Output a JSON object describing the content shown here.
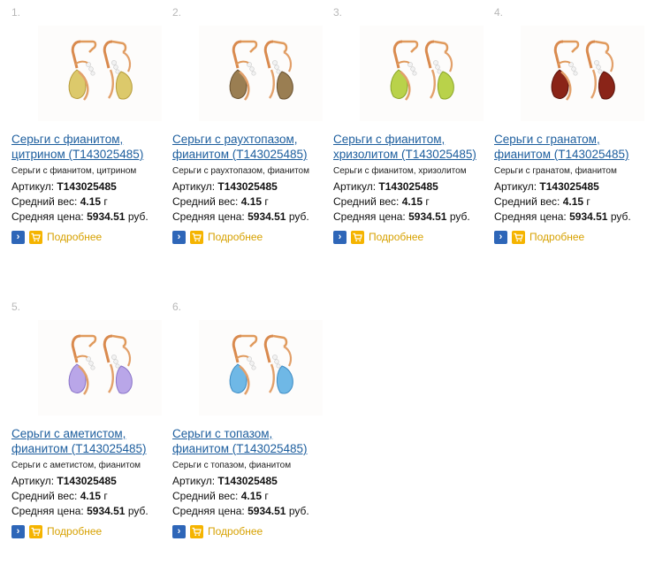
{
  "labels": {
    "article_label": "Артикул:",
    "weight_label": "Средний вес:",
    "price_label": "Средняя цена:",
    "more_label": "Подробнее",
    "go_icon": "›"
  },
  "products": [
    {
      "number": "1.",
      "title_line1": "Серьги с фианитом,",
      "title_line2": "цитрином (T143025485)",
      "desc": "Серьги с фианитом, цитрином",
      "article": "T143025485",
      "weight": "4.15",
      "weight_unit": "г",
      "price": "5934.51",
      "currency": "руб.",
      "stone_color": "#dcc96b",
      "stone_color_dark": "#b79c3c"
    },
    {
      "number": "2.",
      "title_line1": "Серьги с раухтопазом,",
      "title_line2": "фианитом (T143025485)",
      "desc": "Серьги с раухтопазом, фианитом",
      "article": "T143025485",
      "weight": "4.15",
      "weight_unit": "г",
      "price": "5934.51",
      "currency": "руб.",
      "stone_color": "#9a7e52",
      "stone_color_dark": "#6a5230"
    },
    {
      "number": "3.",
      "title_line1": "Серьги с фианитом,",
      "title_line2": "хризолитом (T143025485)",
      "desc": "Серьги с фианитом, хризолитом",
      "article": "T143025485",
      "weight": "4.15",
      "weight_unit": "г",
      "price": "5934.51",
      "currency": "руб.",
      "stone_color": "#b9d24a",
      "stone_color_dark": "#8aa528"
    },
    {
      "number": "4.",
      "title_line1": "Серьги с гранатом,",
      "title_line2": "фианитом (T143025485)",
      "desc": "Серьги с гранатом, фианитом",
      "article": "T143025485",
      "weight": "4.15",
      "weight_unit": "г",
      "price": "5934.51",
      "currency": "руб.",
      "stone_color": "#8a2418",
      "stone_color_dark": "#5a120a"
    },
    {
      "number": "5.",
      "title_line1": "Серьги с аметистом,",
      "title_line2": "фианитом (T143025485)",
      "desc": "Серьги с аметистом, фианитом",
      "article": "T143025485",
      "weight": "4.15",
      "weight_unit": "г",
      "price": "5934.51",
      "currency": "руб.",
      "stone_color": "#b9a6e8",
      "stone_color_dark": "#8a74c8"
    },
    {
      "number": "6.",
      "title_line1": "Серьги с топазом,",
      "title_line2": "фианитом (T143025485)",
      "desc": "Серьги с топазом, фианитом",
      "article": "T143025485",
      "weight": "4.15",
      "weight_unit": "г",
      "price": "5934.51",
      "currency": "руб.",
      "stone_color": "#6fb8e6",
      "stone_color_dark": "#3e8cc4"
    }
  ]
}
